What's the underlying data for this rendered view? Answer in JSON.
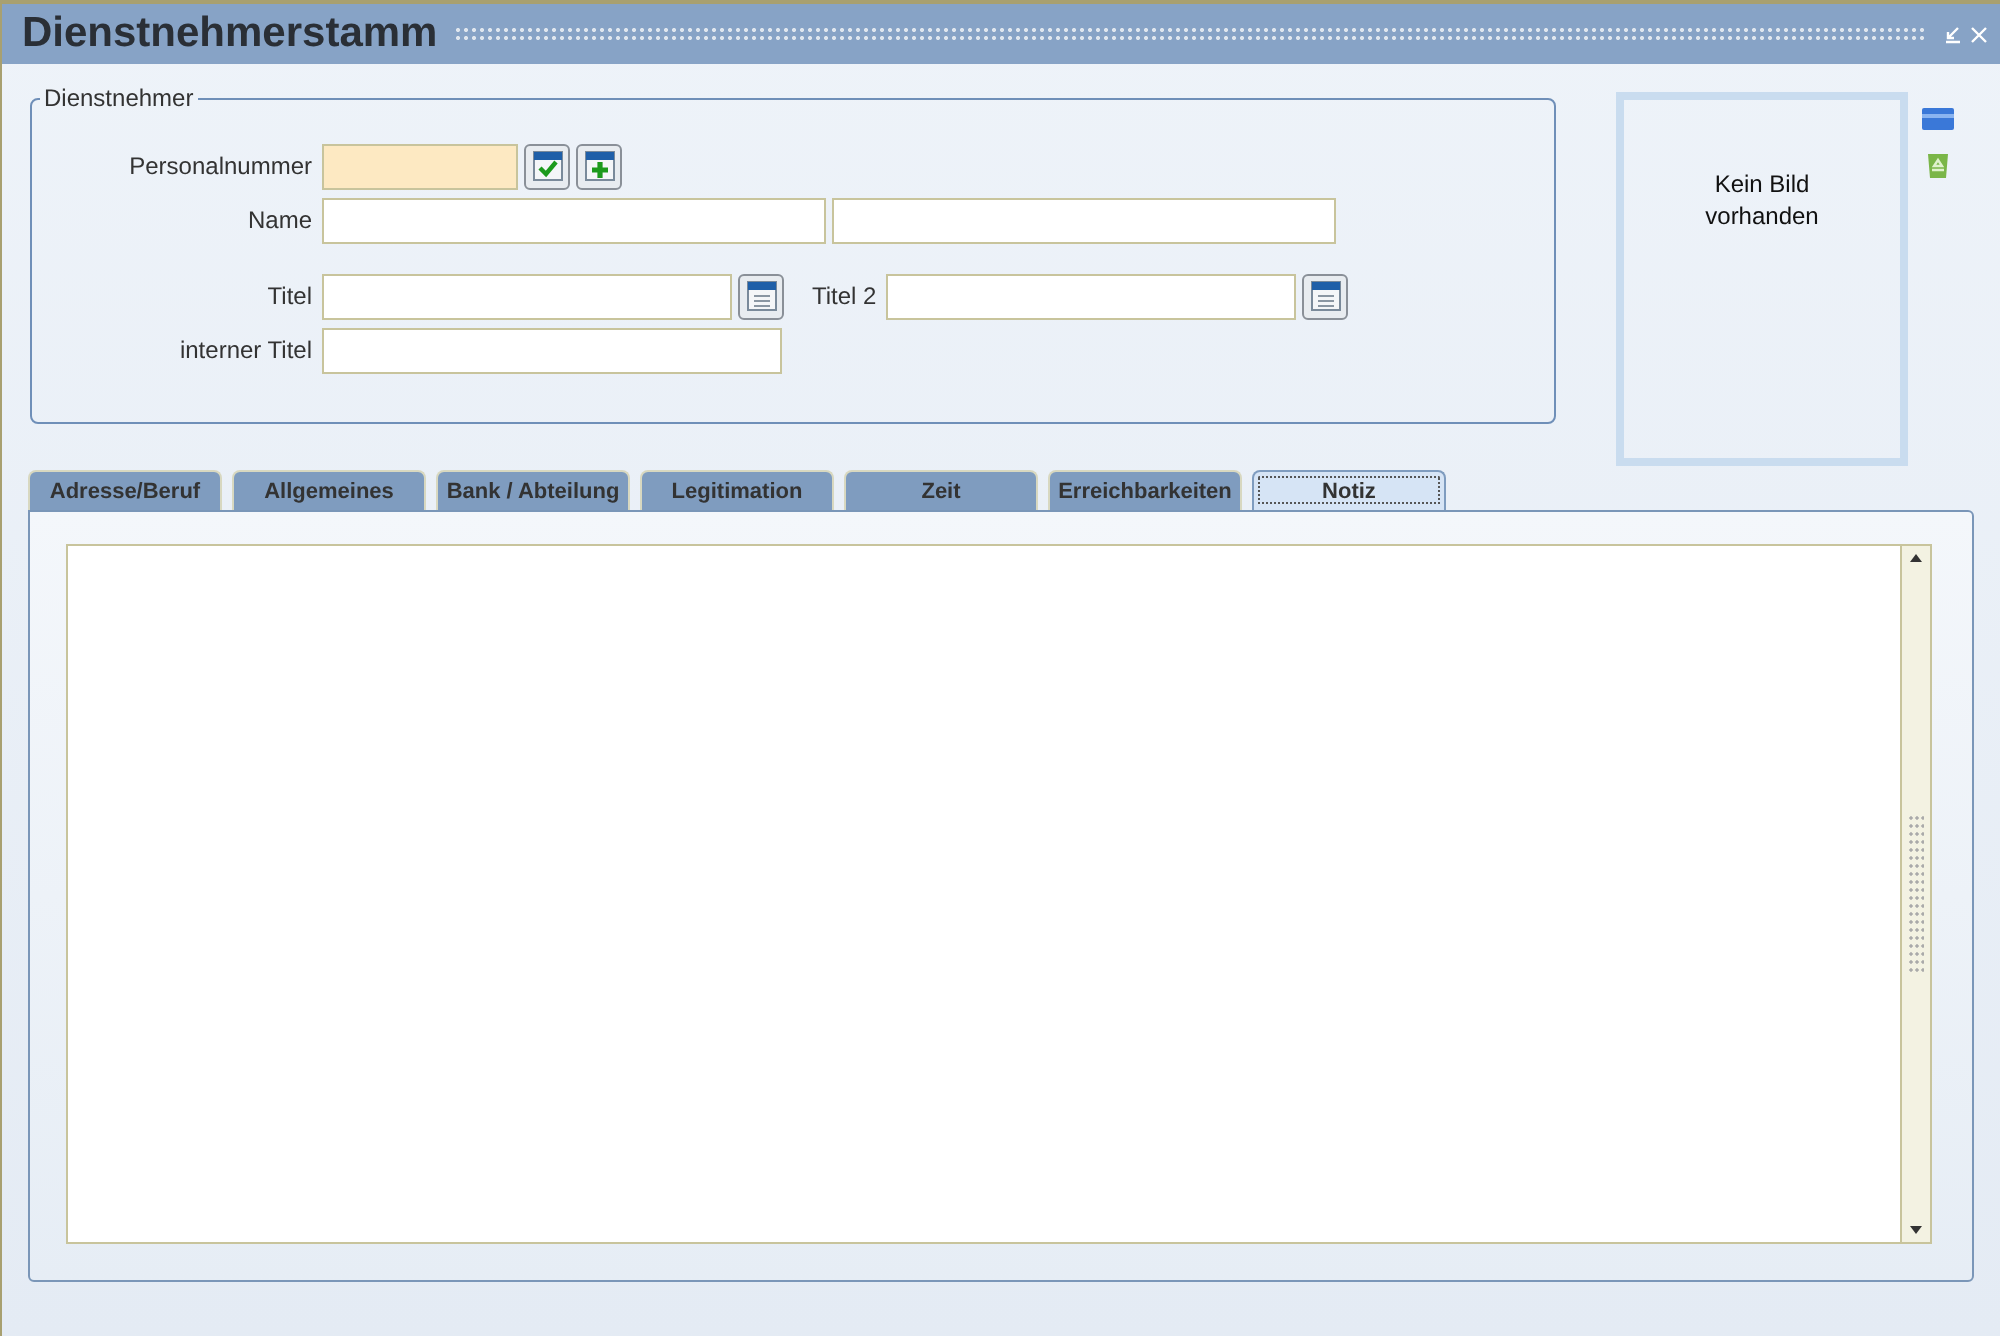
{
  "window": {
    "title": "Dienstnehmerstamm"
  },
  "group": {
    "legend": "Dienstnehmer",
    "rows": [
      {
        "items": [
          {
            "kind": "label",
            "text": "Personalnummer"
          },
          {
            "kind": "field",
            "required": true
          },
          {
            "kind": "confirm"
          },
          {
            "kind": "add"
          }
        ]
      },
      {
        "items": [
          {
            "kind": "label",
            "text": "Name"
          },
          {
            "kind": "field",
            "required": false
          },
          {
            "kind": "field",
            "required": false
          }
        ]
      },
      {
        "items": [
          {
            "kind": "label",
            "text": "Titel"
          },
          {
            "kind": "field",
            "required": false
          },
          {
            "kind": "list"
          },
          {
            "kind": "label2",
            "text": "Titel 2"
          },
          {
            "kind": "field",
            "required": false
          },
          {
            "kind": "list"
          }
        ]
      },
      {
        "items": [
          {
            "kind": "label",
            "text": "interner Titel"
          },
          {
            "kind": "field",
            "required": false
          }
        ]
      }
    ]
  },
  "photo": {
    "text": "Kein Bild vorhanden"
  },
  "tabs": [
    {
      "label": "Adresse/Beruf",
      "selected": false
    },
    {
      "label": "Allgemeines",
      "selected": false
    },
    {
      "label": "Bank / Abteilung",
      "selected": false
    },
    {
      "label": "Legitimation",
      "selected": false
    },
    {
      "label": "Zeit",
      "selected": false
    },
    {
      "label": "Erreichbarkeiten",
      "selected": false
    },
    {
      "label": "Notiz",
      "selected": true
    }
  ]
}
